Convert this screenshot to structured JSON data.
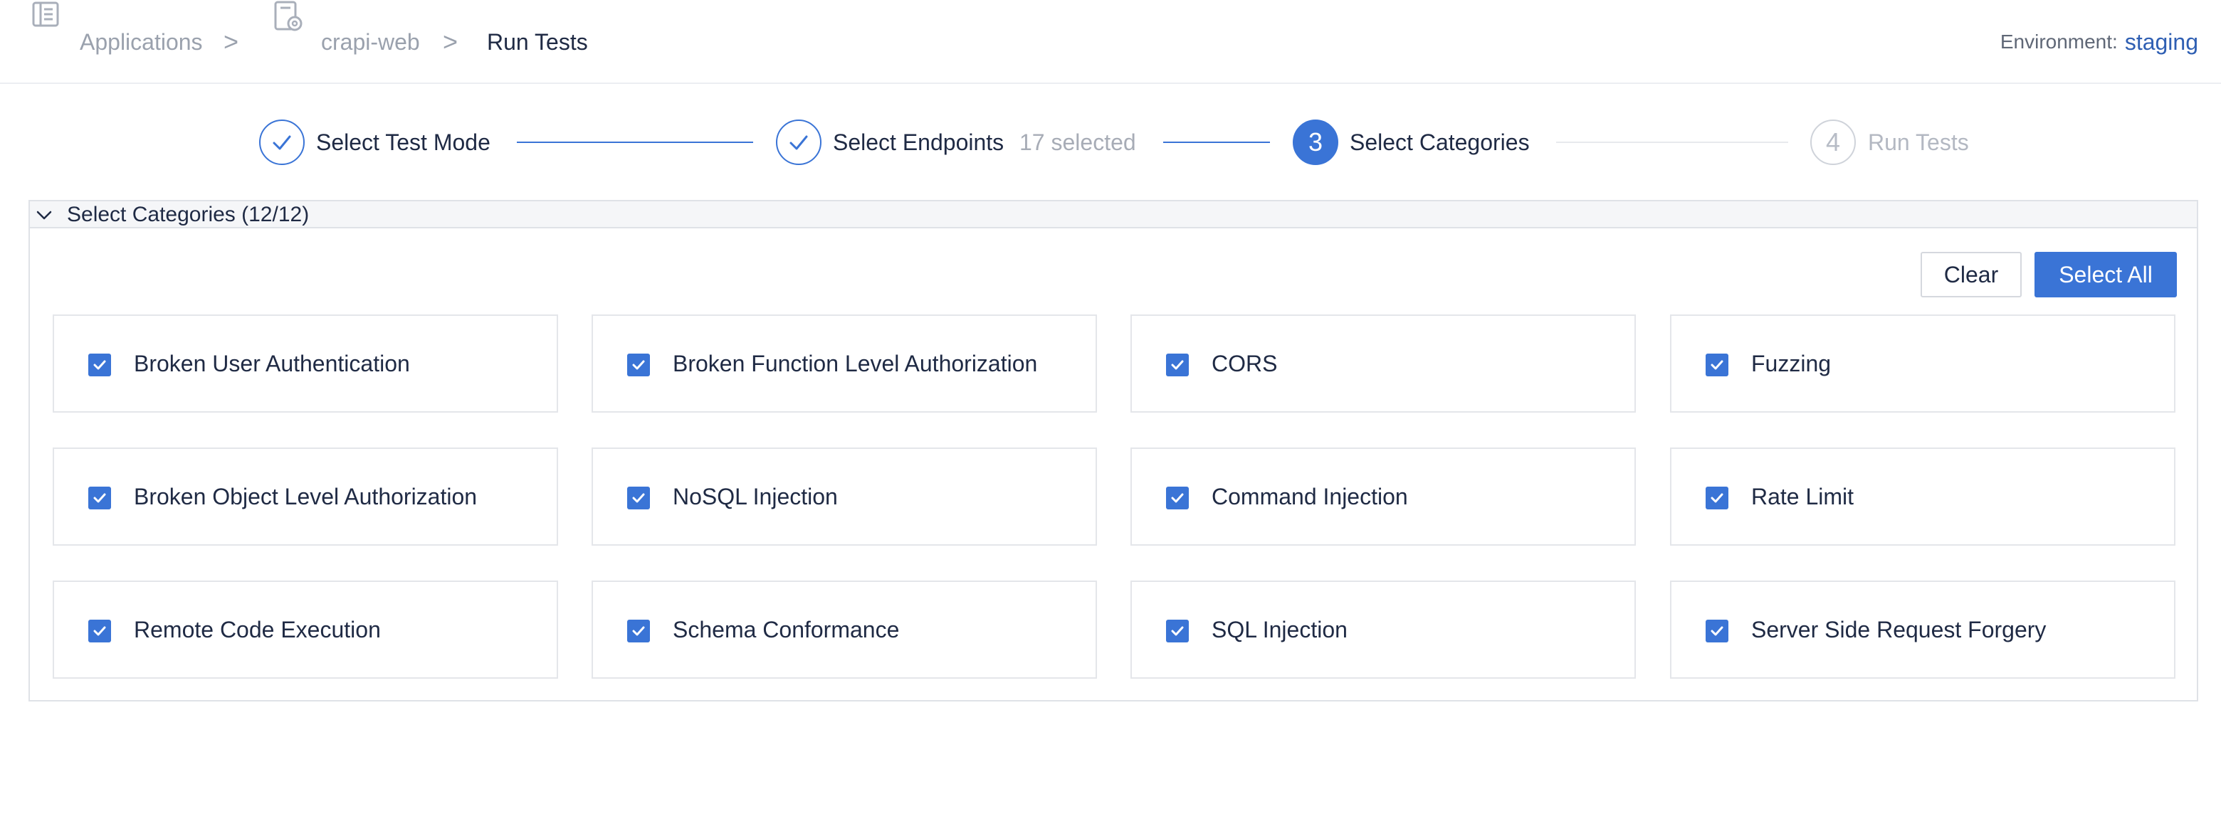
{
  "breadcrumb": {
    "applications": "Applications",
    "app": "crapi-web",
    "current": "Run Tests",
    "separator": ">"
  },
  "environment": {
    "label": "Environment:",
    "value": "staging"
  },
  "stepper": {
    "steps": [
      {
        "number": "1",
        "label": "Select Test Mode",
        "state": "done",
        "sub": ""
      },
      {
        "number": "2",
        "label": "Select Endpoints",
        "state": "done",
        "sub": "17 selected"
      },
      {
        "number": "3",
        "label": "Select Categories",
        "state": "active",
        "sub": ""
      },
      {
        "number": "4",
        "label": "Run Tests",
        "state": "pending",
        "sub": ""
      }
    ]
  },
  "panel": {
    "title": "Select Categories (12/12)",
    "clear_label": "Clear",
    "select_all_label": "Select All"
  },
  "categories": [
    {
      "label": "Broken User Authentication",
      "checked": true
    },
    {
      "label": "Broken Function Level Authorization",
      "checked": true
    },
    {
      "label": "CORS",
      "checked": true
    },
    {
      "label": "Fuzzing",
      "checked": true
    },
    {
      "label": "Broken Object Level Authorization",
      "checked": true
    },
    {
      "label": "NoSQL Injection",
      "checked": true
    },
    {
      "label": "Command Injection",
      "checked": true
    },
    {
      "label": "Rate Limit",
      "checked": true
    },
    {
      "label": "Remote Code Execution",
      "checked": true
    },
    {
      "label": "Schema Conformance",
      "checked": true
    },
    {
      "label": "SQL Injection",
      "checked": true
    },
    {
      "label": "Server Side Request Forgery",
      "checked": true
    }
  ],
  "icons": {
    "applications": "applications-list-icon",
    "app": "app-settings-icon",
    "done": "check-icon",
    "collapse": "chevron-down-icon",
    "checkbox": "checkbox-checked-icon"
  },
  "colors": {
    "accent": "#3a74d6",
    "env_value": "#2f5fb3",
    "muted": "#9aa1ad",
    "text": "#1f2a44"
  }
}
